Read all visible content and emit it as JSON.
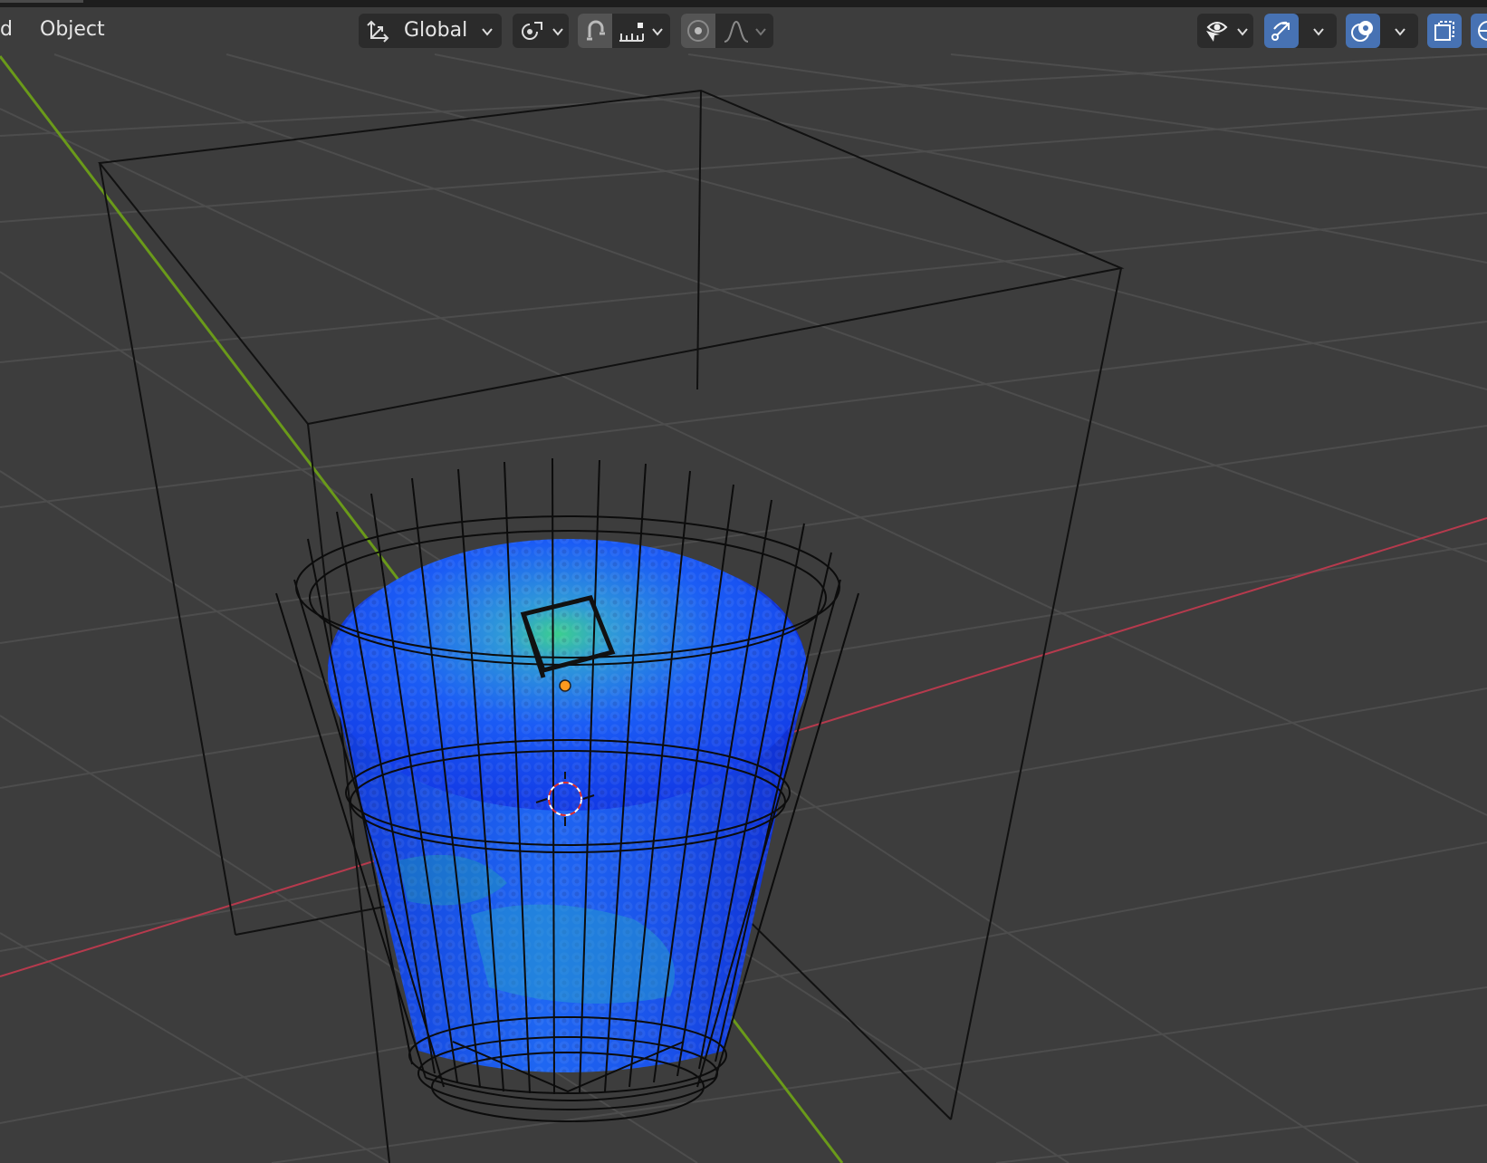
{
  "header": {
    "menu_partial": "d",
    "menu_object": "Object",
    "transform_orientation": "Global"
  },
  "colors": {
    "grid_bg": "#3d3d3d",
    "grid_line": "#4c4c4c",
    "axis_x": "#b63a4d",
    "axis_y": "#6a9a1a",
    "accent": "#4772b3",
    "fluid_deep": "#0f2ddc",
    "fluid_mid": "#1f6bff",
    "fluid_foam": "#3cd58a",
    "origin_dot": "#ff9a1f"
  },
  "icons": [
    "transform-orientation-icon",
    "pivot-point-icon",
    "snap-magnet-icon",
    "snap-increment-icon",
    "proportional-edit-icon",
    "falloff-curve-icon",
    "selectability-visibility-icon",
    "show-gizmo-icon",
    "show-overlays-icon",
    "xray-toggle-icon",
    "viewport-shading-icon",
    "3d-cursor-icon",
    "object-origin-icon"
  ]
}
